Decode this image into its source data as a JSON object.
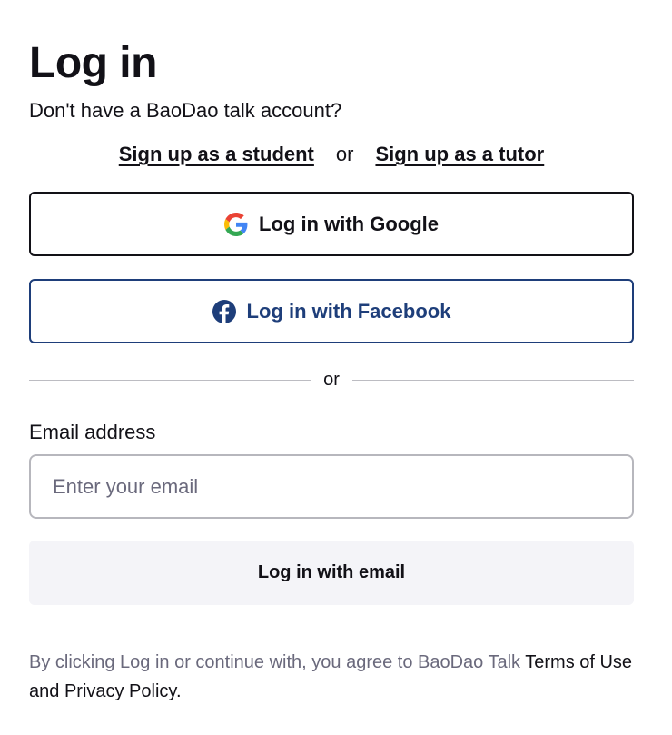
{
  "header": {
    "title": "Log in",
    "subtitle": "Don't have a BaoDao talk account?"
  },
  "signup": {
    "student_label": "Sign up as a student",
    "separator": "or",
    "tutor_label": "Sign up as a tutor"
  },
  "social": {
    "google_label": "Log in with Google",
    "google_icon": "google-icon",
    "facebook_label": "Log in with Facebook",
    "facebook_icon": "facebook-icon",
    "facebook_color": "#1E3E7A"
  },
  "divider": {
    "label": "or"
  },
  "email": {
    "label": "Email address",
    "placeholder": "Enter your email",
    "value": ""
  },
  "email_button": {
    "label": "Log in with email"
  },
  "legal": {
    "prefix": "By clicking Log in or continue with, you agree to BaoDao Talk ",
    "terms_label": "Terms of Use",
    "and": " and ",
    "privacy_label": "Privacy Policy",
    "suffix": "."
  }
}
